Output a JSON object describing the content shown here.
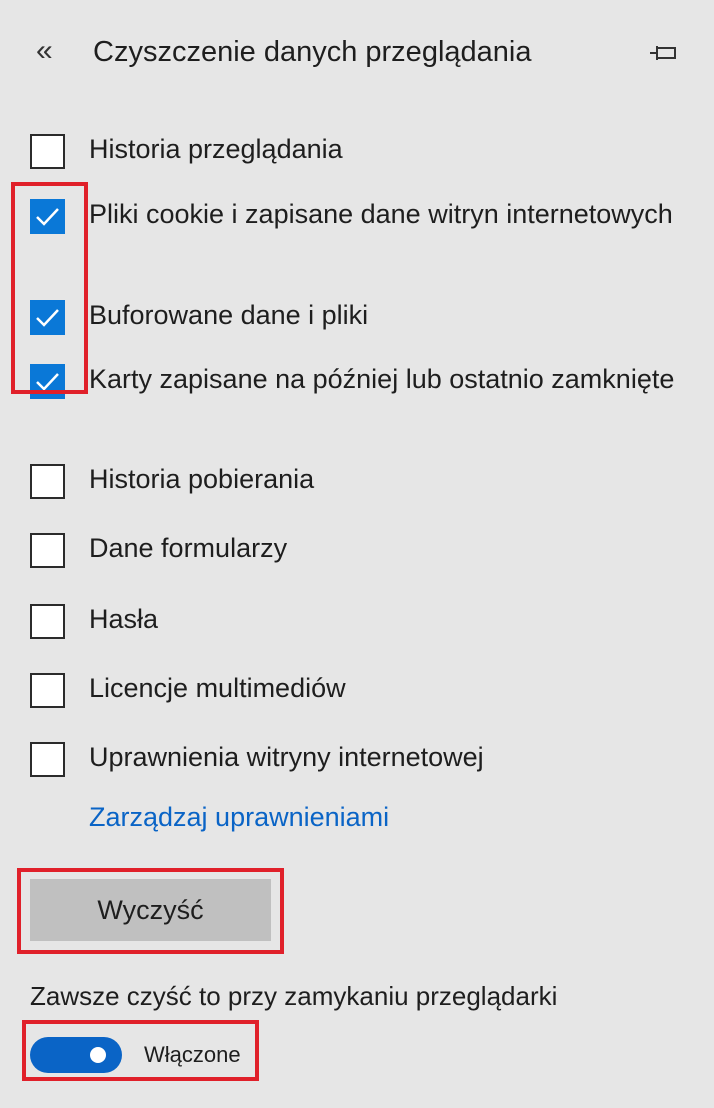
{
  "header": {
    "back_icon_glyph": "«",
    "title": "Czyszczenie danych przeglądania",
    "pin_icon": "pin-icon"
  },
  "options": [
    {
      "label": "Historia przeglądania",
      "checked": false
    },
    {
      "label": "Pliki cookie i zapisane dane witryn internetowych",
      "checked": true
    },
    {
      "label": "Buforowane dane i pliki",
      "checked": true
    },
    {
      "label": "Karty zapisane na później lub ostatnio zamknięte",
      "checked": true
    },
    {
      "label": "Historia pobierania",
      "checked": false
    },
    {
      "label": "Dane formularzy",
      "checked": false
    },
    {
      "label": "Hasła",
      "checked": false
    },
    {
      "label": "Licencje multimediów",
      "checked": false
    },
    {
      "label": "Uprawnienia witryny internetowej",
      "checked": false
    }
  ],
  "manage_link": "Zarządzaj uprawnieniami",
  "clear_button": "Wyczyść",
  "always_clear": {
    "label": "Zawsze czyść to przy zamykaniu przeglądarki",
    "toggle_on": true,
    "toggle_state_label": "Włączone"
  },
  "colors": {
    "background": "#e6e6e6",
    "checkbox_checked": "#0a78d7",
    "link": "#0a64c6",
    "toggle_on": "#0a64c6",
    "button_bg": "#c0c0c0",
    "highlight_border": "#e0202a"
  }
}
